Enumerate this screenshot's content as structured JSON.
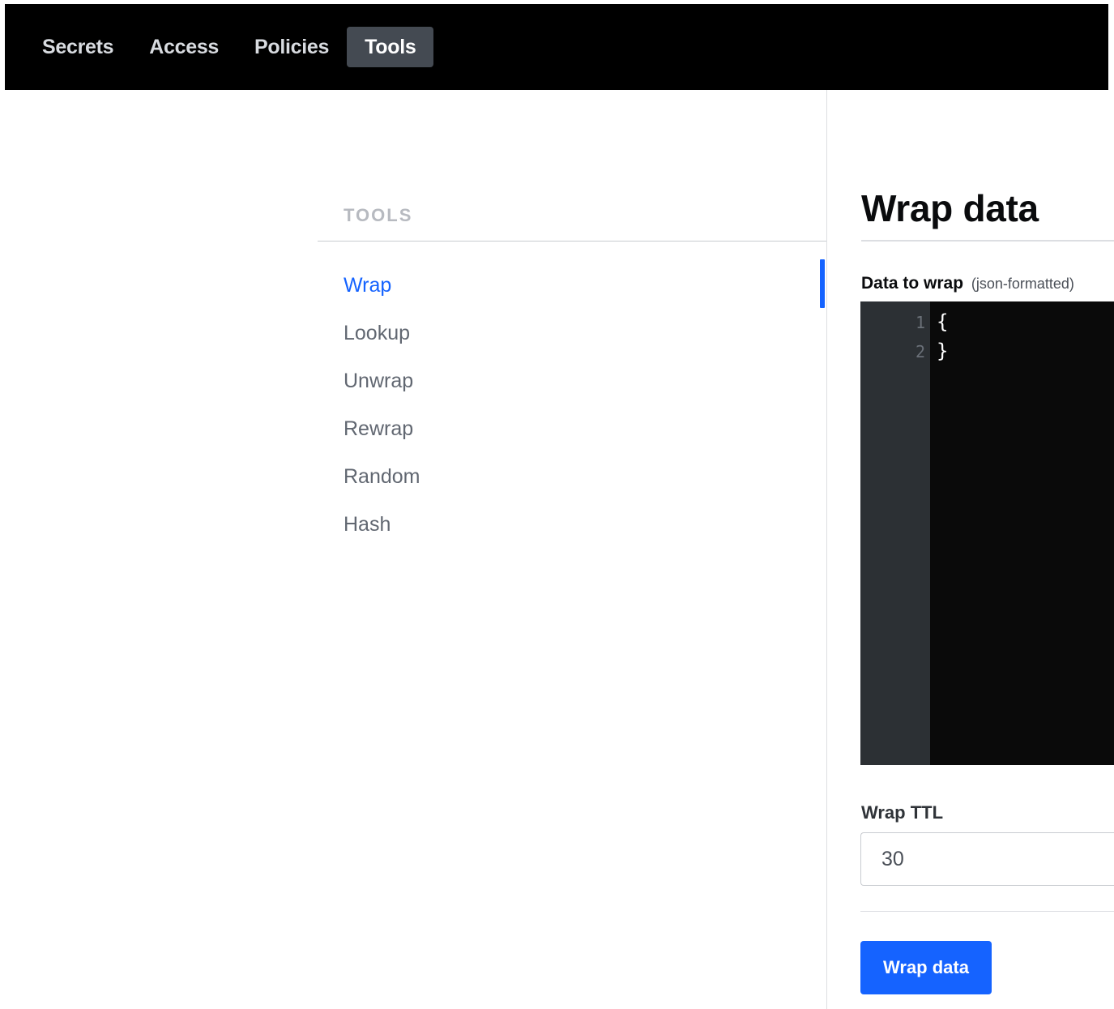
{
  "topnav": {
    "items": [
      {
        "label": "Secrets",
        "active": false
      },
      {
        "label": "Access",
        "active": false
      },
      {
        "label": "Policies",
        "active": false
      },
      {
        "label": "Tools",
        "active": true
      }
    ]
  },
  "sidebar": {
    "heading": "TOOLS",
    "items": [
      {
        "label": "Wrap",
        "active": true
      },
      {
        "label": "Lookup",
        "active": false
      },
      {
        "label": "Unwrap",
        "active": false
      },
      {
        "label": "Rewrap",
        "active": false
      },
      {
        "label": "Random",
        "active": false
      },
      {
        "label": "Hash",
        "active": false
      }
    ]
  },
  "main": {
    "title": "Wrap data",
    "data_field": {
      "label": "Data to wrap",
      "sublabel": "(json-formatted)",
      "lines": [
        {
          "num": "1",
          "text": "{"
        },
        {
          "num": "2",
          "text": "}"
        }
      ]
    },
    "ttl_field": {
      "label": "Wrap TTL",
      "value": "30"
    },
    "submit_label": "Wrap data"
  },
  "colors": {
    "accent": "#1563ff",
    "topbar": "#000000",
    "editor_bg": "#0a0a0a",
    "gutter_bg": "#2c3034"
  }
}
